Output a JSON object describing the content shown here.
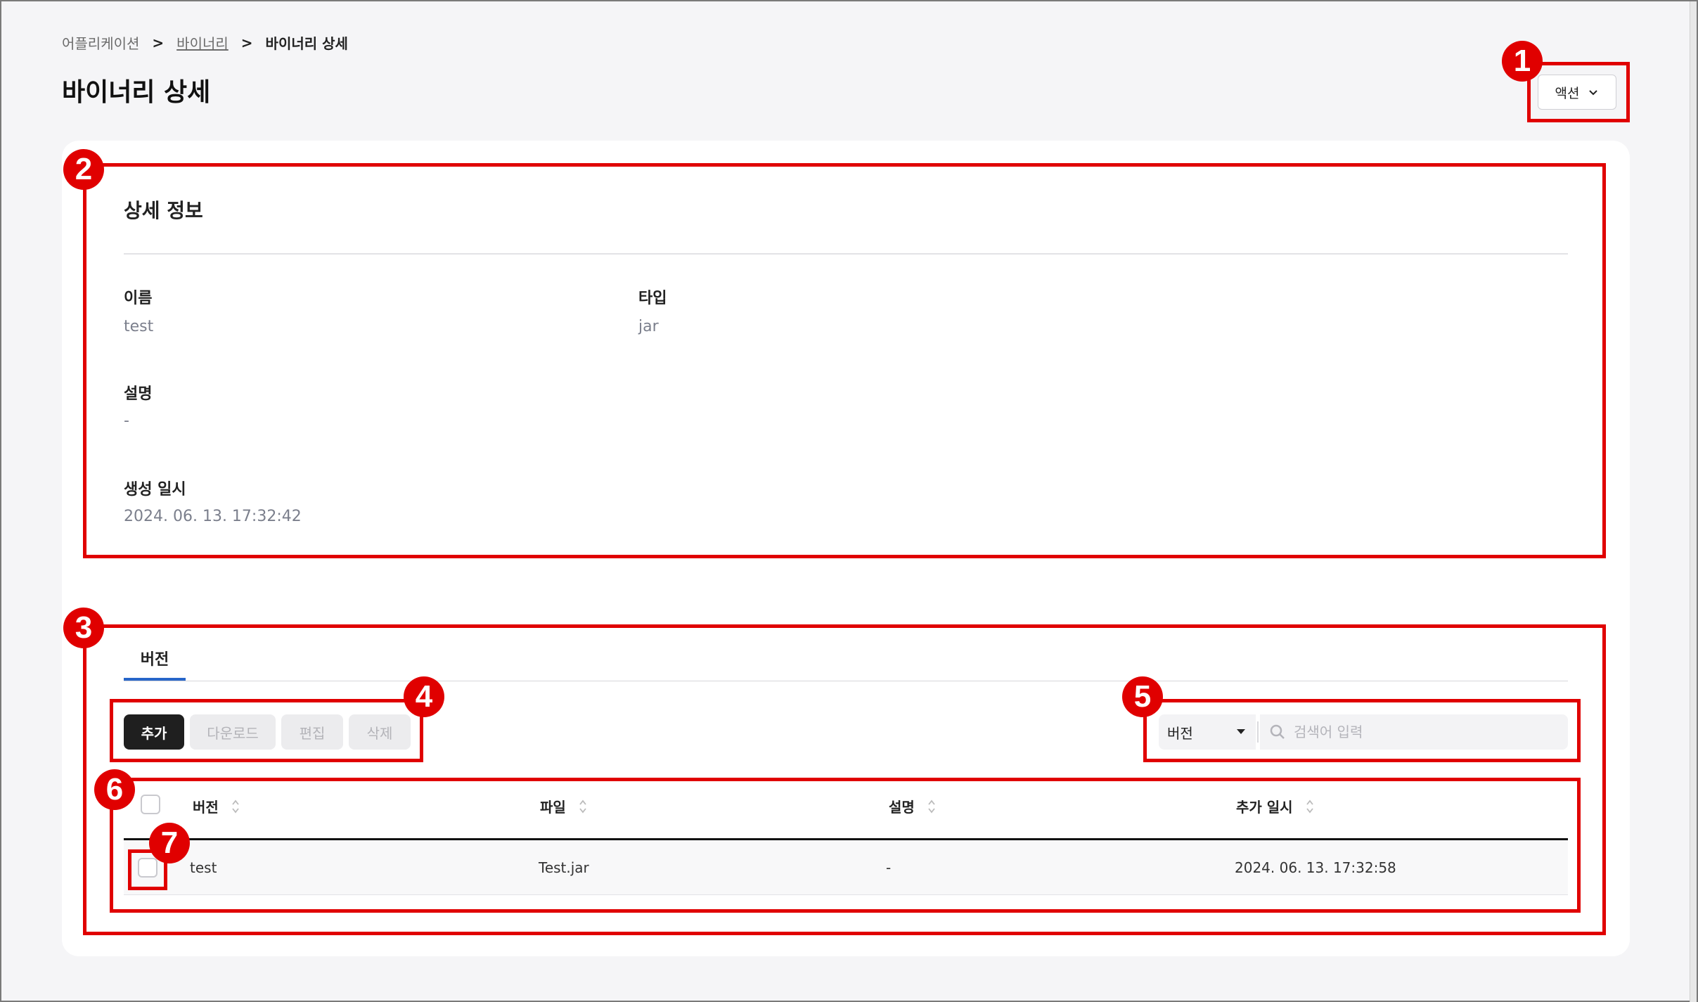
{
  "breadcrumb": {
    "items": [
      "어플리케이션",
      "바이너리",
      "바이너리 상세"
    ],
    "separator": ">"
  },
  "page_title": "바이너리 상세",
  "action_button": {
    "label": "액션",
    "icon": "chevron-down-icon"
  },
  "details": {
    "title": "상세 정보",
    "fields": {
      "name_label": "이름",
      "name_value": "test",
      "type_label": "타입",
      "type_value": "jar",
      "description_label": "설명",
      "description_value": "-",
      "created_label": "생성 일시",
      "created_value": "2024. 06. 13. 17:32:42"
    }
  },
  "tabs": [
    {
      "label": "버전",
      "active": true
    }
  ],
  "toolbar": {
    "add": "추가",
    "download": "다운로드",
    "edit": "편집",
    "delete": "삭제"
  },
  "filter": {
    "selected": "버전",
    "search_placeholder": "검색어 입력"
  },
  "table": {
    "columns": [
      "버전",
      "파일",
      "설명",
      "추가 일시"
    ],
    "rows": [
      {
        "version": "test",
        "file": "Test.jar",
        "description": "-",
        "added": "2024. 06. 13. 17:32:58"
      }
    ]
  },
  "annotations": [
    "1",
    "2",
    "3",
    "4",
    "5",
    "6",
    "7"
  ],
  "colors": {
    "annotation": "#e00000",
    "tab_accent": "#2766c9",
    "primary_button": "#1f1f1f"
  }
}
